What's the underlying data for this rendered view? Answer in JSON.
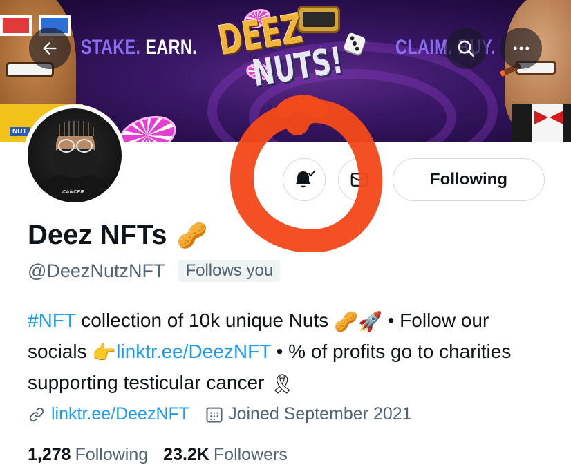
{
  "banner": {
    "left_text_1": "STAKE.",
    "left_text_2": "EARN.",
    "logo_line1": "DEEZ",
    "logo_line2": "NUTS!",
    "right_text": "CLAIM. BUY.",
    "left_tag": "NUT",
    "icons": {
      "back": "arrow-left-icon",
      "search": "search-icon",
      "more": "more-icon"
    }
  },
  "avatar": {
    "shirt_text": "CANCER"
  },
  "actions": {
    "notifications_icon": "bell-check-icon",
    "message_icon": "envelope-icon",
    "following_label": "Following"
  },
  "profile": {
    "display_name": "Deez NFTs",
    "name_emoji": "🥜",
    "handle": "@DeezNutzNFT",
    "follows_you": "Follows you"
  },
  "bio": {
    "hashtag": "#NFT",
    "text_1": " collection of 10k unique Nuts ",
    "emoji_1": "🥜",
    "emoji_2": "🚀",
    "text_2": " • Follow our socials ",
    "emoji_3": "👉",
    "link": "linktr.ee/DeezNFT",
    "text_3": " • % of profits go to charities supporting testicular cancer ",
    "emoji_4": "🎗"
  },
  "meta": {
    "website": "linktr.ee/DeezNFT",
    "joined": "Joined September 2021",
    "link_icon": "link-icon",
    "calendar_icon": "calendar-icon"
  },
  "stats": {
    "following_count": "1,278",
    "following_label": "Following",
    "followers_count": "23.2K",
    "followers_label": "Followers"
  },
  "colors": {
    "link_blue": "#1d9bf0",
    "secondary_text": "#536471",
    "scribble_red": "#f24a1a",
    "banner_purple": "#3a1766"
  }
}
